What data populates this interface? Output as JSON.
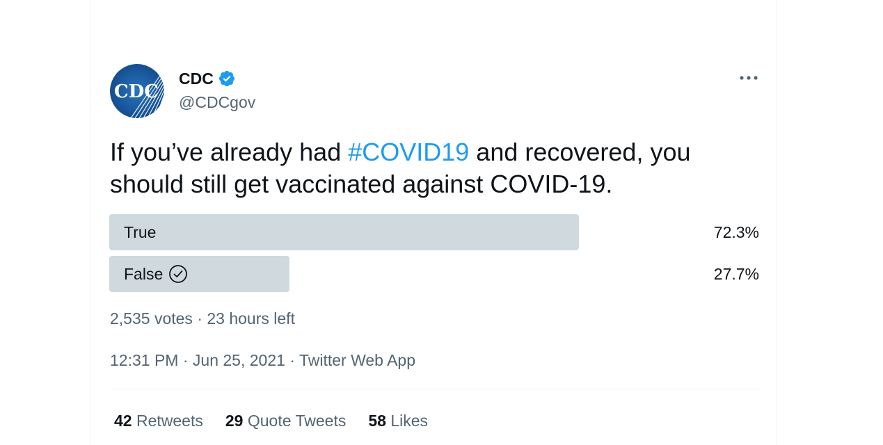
{
  "author": {
    "name": "CDC",
    "handle": "@CDCgov",
    "avatar_text": "CDC",
    "verified": true,
    "avatar_icon": "cdc-logo",
    "verified_icon": "verified-badge-icon"
  },
  "tweet": {
    "text_before": "If you’ve already had ",
    "hashtag": "#COVID19",
    "text_after": " and recovered, you should still get vaccinated against COVID-19."
  },
  "poll": {
    "options": [
      {
        "label": "True",
        "percent": "72.3%",
        "fraction": 0.723,
        "selected": false
      },
      {
        "label": "False",
        "percent": "27.7%",
        "fraction": 0.277,
        "selected": true
      }
    ],
    "votes": "2,535 votes",
    "separator": "·",
    "time_left": "23 hours left"
  },
  "meta": {
    "time": "12:31 PM",
    "date": "Jun 25, 2021",
    "source": "Twitter Web App",
    "separator": "·"
  },
  "stats": {
    "retweets_count": "42",
    "retweets_label": "Retweets",
    "quotes_count": "29",
    "quotes_label": "Quote Tweets",
    "likes_count": "58",
    "likes_label": "Likes"
  },
  "colors": {
    "accent": "#1d9bf0",
    "poll_bar": "#cfd9de",
    "secondary_text": "#536471",
    "avatar_bg": "#1a5fa8"
  }
}
